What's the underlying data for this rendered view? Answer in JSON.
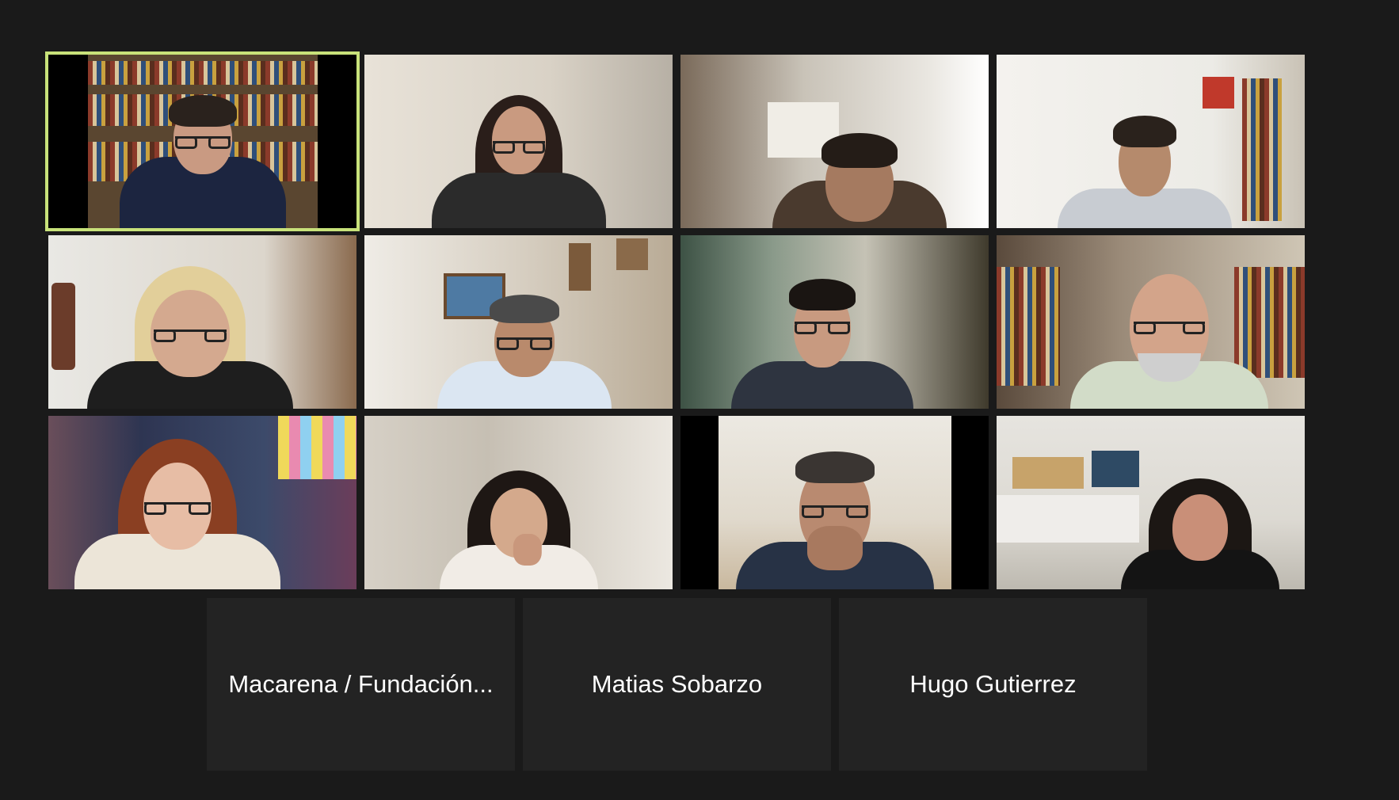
{
  "window": {
    "background": "#1a1a1a",
    "active_speaker_color": "#c8e27a"
  },
  "video_grid": {
    "tiles": [
      {
        "id": "participant-1",
        "active_speaker": true,
        "description_icon": "video-feed"
      },
      {
        "id": "participant-2",
        "active_speaker": false,
        "description_icon": "video-feed"
      },
      {
        "id": "participant-3",
        "active_speaker": false,
        "description_icon": "video-feed"
      },
      {
        "id": "participant-4",
        "active_speaker": false,
        "description_icon": "video-feed"
      },
      {
        "id": "participant-5",
        "active_speaker": false,
        "description_icon": "video-feed"
      },
      {
        "id": "participant-6",
        "active_speaker": false,
        "description_icon": "video-feed"
      },
      {
        "id": "participant-7",
        "active_speaker": false,
        "description_icon": "video-feed"
      },
      {
        "id": "participant-8",
        "active_speaker": false,
        "description_icon": "video-feed"
      },
      {
        "id": "participant-9",
        "active_speaker": false,
        "description_icon": "video-feed"
      },
      {
        "id": "participant-10",
        "active_speaker": false,
        "description_icon": "video-feed"
      },
      {
        "id": "participant-11",
        "active_speaker": false,
        "description_icon": "video-feed"
      },
      {
        "id": "participant-12",
        "active_speaker": false,
        "description_icon": "video-feed"
      }
    ]
  },
  "name_only_tiles": [
    {
      "name": "Macarena / Fundación..."
    },
    {
      "name": "Matias Sobarzo"
    },
    {
      "name": "Hugo Gutierrez"
    }
  ]
}
